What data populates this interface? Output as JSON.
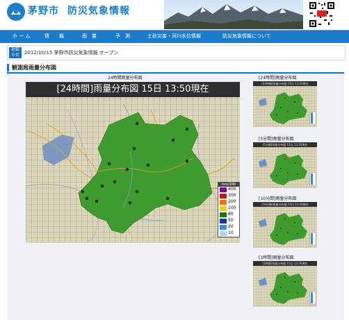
{
  "header": {
    "city": "茅野市",
    "site_name": "防災気象情報"
  },
  "nav": [
    {
      "label": "ホ ー ム"
    },
    {
      "label": "情　　報"
    },
    {
      "label": "雨　量"
    },
    {
      "label": "予　測"
    },
    {
      "label": "土砂災害・河川水位情報"
    },
    {
      "label": "防災気象情報について"
    }
  ],
  "news": {
    "tag_line1": "お知",
    "tag_line2": "らせ",
    "text": "2012/10/15 茅野市防災気象情報 オープン"
  },
  "section": {
    "title": "観測局雨量分布図"
  },
  "main_map": {
    "caption": "24時間雨量分布図",
    "header": "[24時間]雨量分布図 15日 13:50現在"
  },
  "legend": {
    "unit": "mm/24h",
    "levels": [
      {
        "label": "400",
        "color": "#7a0a9a"
      },
      {
        "label": "300",
        "color": "#d01010"
      },
      {
        "label": "200",
        "color": "#f07010"
      },
      {
        "label": "100",
        "color": "#f0d000"
      },
      {
        "label": "80",
        "color": "#207020"
      },
      {
        "label": "50",
        "color": "#103c9c"
      },
      {
        "label": "20",
        "color": "#3a8ae8"
      },
      {
        "label": "10",
        "color": "#a8d8f8"
      }
    ]
  },
  "thumbs": [
    {
      "caption": "[24時間]雨量分布図",
      "header": "[24時間]雨量分布図 15日 13:50現在"
    },
    {
      "caption": "[5分間]雨量分布図",
      "header": "[5分間]雨量分布図 15日 13:50現在"
    },
    {
      "caption": "[10分間]雨量分布図",
      "header": "[10分間]雨量分布図 15日 13:50現在"
    },
    {
      "caption": "[1時間]雨量分布図",
      "header": "[1時間]雨量分布図 15日 13:50現在"
    }
  ],
  "colors": {
    "brand_blue": "#1e7fc7",
    "nav_blue": "#1f7bc8",
    "area_green": "#3f9b2e"
  }
}
